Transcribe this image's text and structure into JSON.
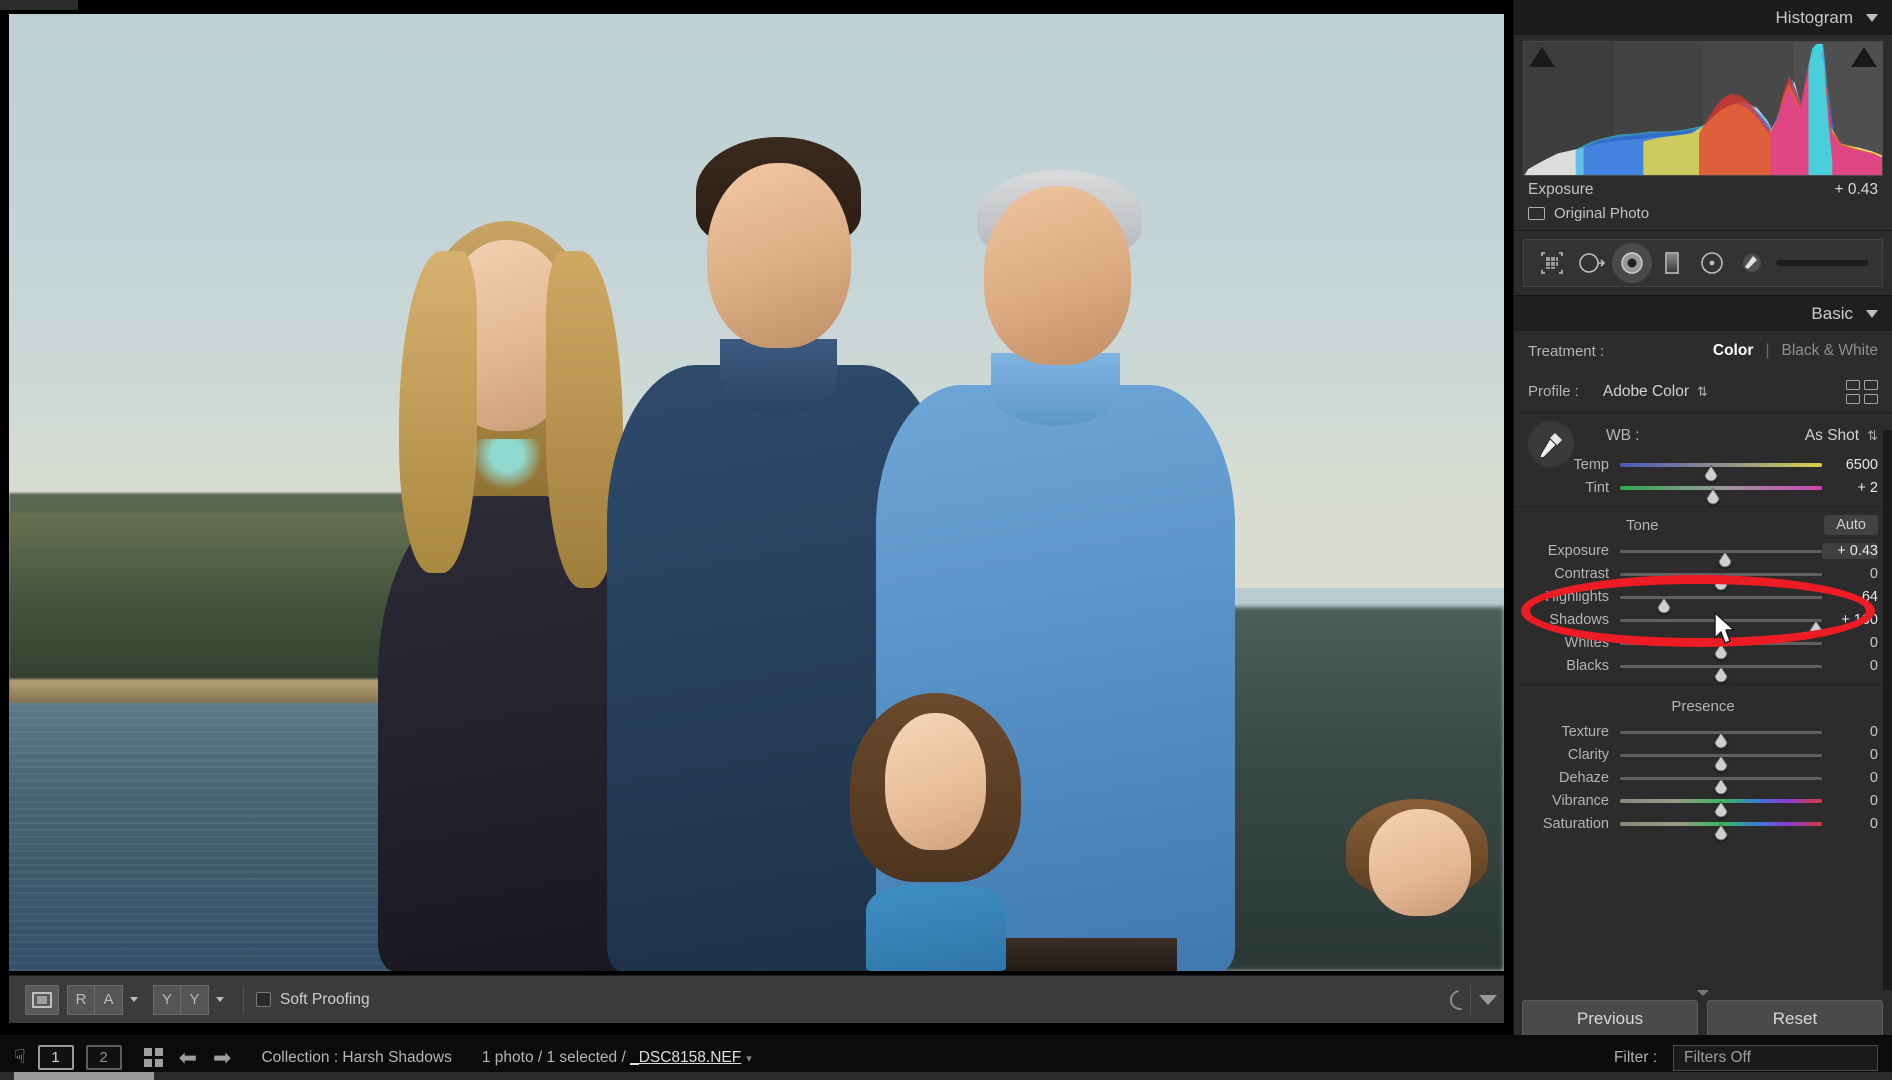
{
  "histogram_panel": {
    "title": "Histogram",
    "collapse_icon": "triangle-down-icon",
    "readout_label": "Exposure",
    "readout_value": "+ 0.43",
    "original_photo_label": "Original Photo",
    "original_photo_icon": "rectangle-icon",
    "clip_left_icon": "shadow-clipping-triangle-icon",
    "clip_right_icon": "highlight-clipping-triangle-icon"
  },
  "tool_strip": {
    "tools": [
      {
        "name": "crop-overlay-tool",
        "icon": "crop-icon",
        "active": false
      },
      {
        "name": "spot-removal-tool",
        "icon": "spot-removal-circle-icon",
        "active": false
      },
      {
        "name": "red-eye-correction-tool",
        "icon": "eye-icon",
        "active": true
      },
      {
        "name": "graduated-filter-tool",
        "icon": "graduated-filter-icon",
        "active": false
      },
      {
        "name": "radial-filter-tool",
        "icon": "radial-filter-icon",
        "active": false
      },
      {
        "name": "adjustment-brush-tool",
        "icon": "brush-icon",
        "active": false
      }
    ]
  },
  "basic_panel": {
    "title": "Basic",
    "collapse_icon": "triangle-down-icon",
    "treatment": {
      "label": "Treatment :",
      "color_option": "Color",
      "separator": "|",
      "bw_option": "Black & White",
      "selected": "Color"
    },
    "profile": {
      "label": "Profile :",
      "value": "Adobe Color",
      "stepper_icon": "up-down-stepper-icon",
      "browse_icon": "grid-browse-profiles-icon"
    },
    "white_balance": {
      "eyedropper_icon": "eyedropper-icon",
      "label": "WB :",
      "value": "As Shot",
      "stepper_icon": "up-down-stepper-icon",
      "sliders": [
        {
          "name": "Temp",
          "value": "6500",
          "pos": 45,
          "track": "temp"
        },
        {
          "name": "Tint",
          "value": "+ 2",
          "pos": 46,
          "track": "tint"
        }
      ]
    },
    "tone": {
      "label": "Tone",
      "auto_label": "Auto",
      "sliders": [
        {
          "name": "Exposure",
          "value": "+ 0.43",
          "pos": 52,
          "track": "plain",
          "highlighted": true
        },
        {
          "name": "Contrast",
          "value": "0",
          "pos": 50,
          "track": "plain",
          "highlighted": false
        },
        {
          "name": "Highlights",
          "value": "– 64",
          "pos": 22,
          "track": "plain",
          "highlighted": false
        },
        {
          "name": "Shadows",
          "value": "+ 100",
          "pos": 97,
          "track": "plain",
          "highlighted": false
        },
        {
          "name": "Whites",
          "value": "0",
          "pos": 50,
          "track": "plain",
          "highlighted": false
        },
        {
          "name": "Blacks",
          "value": "0",
          "pos": 50,
          "track": "plain",
          "highlighted": false
        }
      ]
    },
    "presence": {
      "label": "Presence",
      "sliders": [
        {
          "name": "Texture",
          "value": "0",
          "pos": 50,
          "track": "plain"
        },
        {
          "name": "Clarity",
          "value": "0",
          "pos": 50,
          "track": "plain"
        },
        {
          "name": "Dehaze",
          "value": "0",
          "pos": 50,
          "track": "plain"
        },
        {
          "name": "Vibrance",
          "value": "0",
          "pos": 50,
          "track": "vib"
        },
        {
          "name": "Saturation",
          "value": "0",
          "pos": 50,
          "track": "vib"
        }
      ]
    },
    "buttons": {
      "previous": "Previous",
      "reset": "Reset"
    }
  },
  "image_toolbar": {
    "loupe_view_icon": "loupe-view-icon",
    "compare_labels": [
      "R",
      "A"
    ],
    "compare_caret_icon": "caret-down-icon",
    "beforeafter_labels": [
      "Y",
      "Y"
    ],
    "beforeafter_caret_icon": "caret-down-icon",
    "soft_proofing_label": "Soft Proofing",
    "soft_proofing_checked": false,
    "spinner_icon": "loading-spinner-icon",
    "panel_toggle_icon": "triangle-down-icon"
  },
  "filmstrip_bar": {
    "hand_icon": "grabber-hand-icon",
    "monitor_one": "1",
    "monitor_two": "2",
    "grid_icon": "grid-view-icon",
    "prev_icon": "arrow-left-icon",
    "next_icon": "arrow-right-icon",
    "collection_text": "Collection : Harsh Shadows",
    "photo_count_text": "1 photo / 1 selected / ",
    "filename": "_DSC8158.NEF",
    "filename_caret_icon": "caret-down-icon",
    "filter_label": "Filter :",
    "filter_value": "Filters Off"
  },
  "annotation": {
    "shape": "ellipse-highlight",
    "color": "#ed1c24",
    "target": "Exposure slider row",
    "cursor_icon": "arrow-cursor-icon"
  },
  "colors": {
    "panel_bg": "#2c2c2c",
    "panel_header_bg": "#1c1c1c",
    "annotation_red": "#ed1c24",
    "text_primary": "#cdcdcd",
    "text_secondary": "#b4b4b4"
  }
}
